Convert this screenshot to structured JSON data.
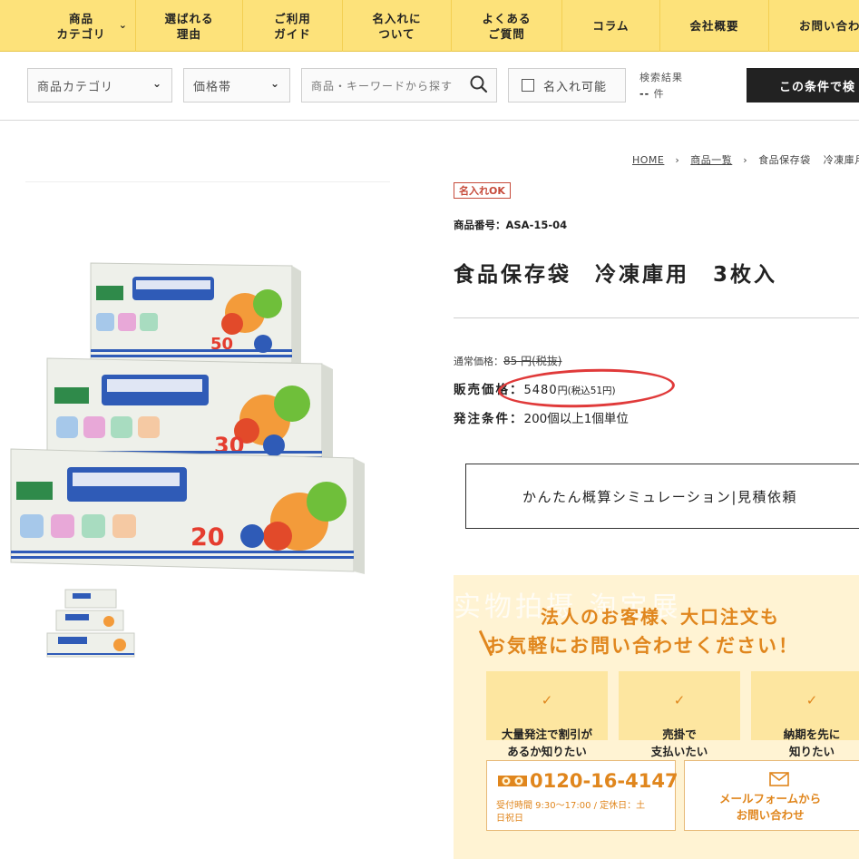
{
  "nav": {
    "items": [
      {
        "label": "商品\nカテゴリ"
      },
      {
        "label": "選ばれる\n理由"
      },
      {
        "label": "ご利用\nガイド"
      },
      {
        "label": "名入れに\nついて"
      },
      {
        "label": "よくある\nご質問"
      },
      {
        "label": "コラム"
      },
      {
        "label": "会社概要"
      },
      {
        "label": "お問い合わ"
      }
    ]
  },
  "filters": {
    "category_select": "商品カテゴリ",
    "price_select": "価格帯",
    "search_placeholder": "商品・キーワードから探す",
    "name_print_checkbox": "名入れ可能",
    "result_label": "検索結果",
    "result_value": "--",
    "result_unit": "件",
    "apply_button": "この条件で検"
  },
  "breadcrumb": {
    "home": "HOME",
    "list": "商品一覧",
    "category": "食品保存袋",
    "current": "冷凍庫月"
  },
  "product": {
    "badge": "名入れOK",
    "sku": "商品番号：ASA-15-04",
    "title": "食品保存袋　冷凍庫用　3枚入",
    "regular_label": "通常価格：",
    "regular_price": "85 円(税抜)",
    "sale_label": "販売価格：",
    "sale_price": "5480",
    "sale_unit": "円",
    "sale_tax": "(税込51円)",
    "order_label": "発注条件：",
    "order_value": "200個以上1個単位",
    "estimate_button": "かんたん概算シミュレーション|見積依頼"
  },
  "cta": {
    "watermark": "实物拍摄 淘宝展",
    "heading1": "法人のお客様、大口注文も",
    "heading2": "お気軽にお問い合わせください！",
    "features": [
      {
        "label": "大量発注で割引が\nあるか知りたい"
      },
      {
        "label": "売掛で\n支払いたい"
      },
      {
        "label": "納期を先に\n知りたい"
      }
    ],
    "phone": "0120-16-4147",
    "hours": "受付時間 9:30〜17:00 / 定休日：土\n日祝日",
    "mail": "メールフォームから\nお問い合わせ"
  },
  "colors": {
    "nav_bg": "#fde27a",
    "accent_orange": "#e0861d",
    "badge_red": "#c64a3a",
    "annotation_red": "#e03a3a",
    "cta_bg": "#fff3d3"
  },
  "icons": [
    "chevron-down-icon",
    "search-icon",
    "checkbox-icon",
    "check-icon",
    "free-dial-icon",
    "envelope-icon",
    "breadcrumb-chevron-icon"
  ]
}
